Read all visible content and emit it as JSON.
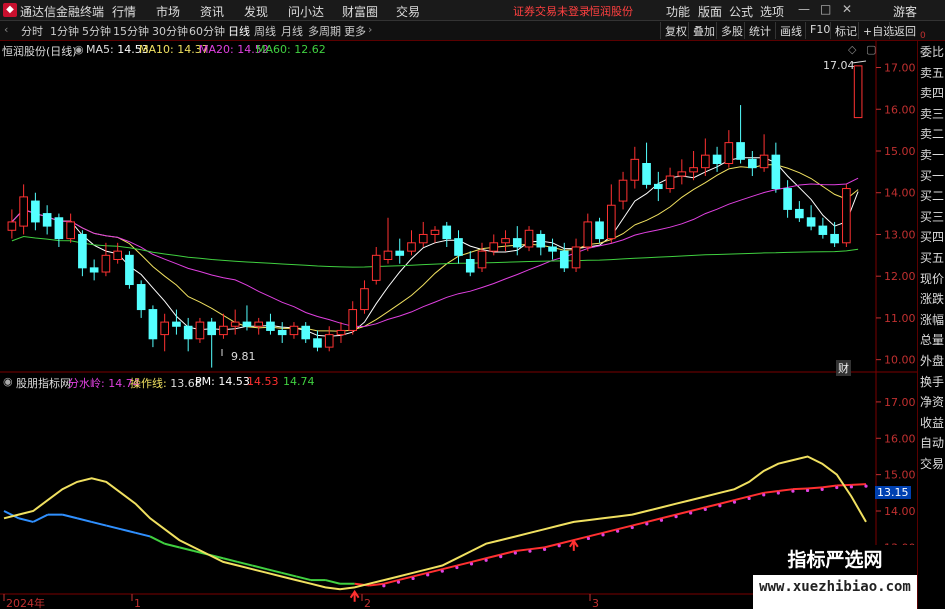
{
  "topbar": {
    "app_name": "通达信金融终端",
    "menus": [
      "行情",
      "市场",
      "资讯",
      "发现",
      "问小达",
      "财富圈",
      "交易"
    ],
    "warning": "证券交易未登录",
    "stock_name": "恒润股份",
    "right_menus": [
      "功能",
      "版面",
      "公式",
      "选项"
    ],
    "user": "游客"
  },
  "toolbar": {
    "periods": [
      "分时",
      "1分钟",
      "5分钟",
      "15分钟",
      "30分钟",
      "60分钟",
      "日线",
      "周线",
      "月线",
      "多周期",
      "更多"
    ],
    "active_period": "日线",
    "buttons": [
      "复权",
      "叠加",
      "多股",
      "统计",
      "画线",
      "F10",
      "标记",
      "+自选",
      "返回"
    ]
  },
  "right_column": {
    "top_label": "0",
    "items": [
      "委比",
      "卖五",
      "卖四",
      "卖三",
      "卖二",
      "卖一",
      "买一",
      "买二",
      "买三",
      "买四",
      "买五",
      "现价",
      "涨跌",
      "涨幅",
      "总量",
      "外盘",
      "换手",
      "净资",
      "收益",
      "自动",
      "交易"
    ]
  },
  "main_chart": {
    "title": "恒润股份(日线)",
    "ma": [
      {
        "label": "MA5:",
        "value": "14.53",
        "color": "#ffffff"
      },
      {
        "label": "MA10:",
        "value": "14.37",
        "color": "#f0e060"
      },
      {
        "label": "MA20:",
        "value": "14.52",
        "color": "#e040e0"
      },
      {
        "label": "MA60:",
        "value": "12.62",
        "color": "#40d040"
      }
    ],
    "y_ticks": [
      "17.00",
      "16.00",
      "15.00",
      "14.00",
      "13.00",
      "12.00",
      "11.00",
      "10.00"
    ],
    "high_label": "17.04",
    "low_label": "9.81",
    "marker_label": "财"
  },
  "sub_chart": {
    "indicator_name": "股朋指标网",
    "fields": [
      {
        "label": "分水岭:",
        "value": "14.74",
        "color": "#e040e0"
      },
      {
        "label": "操作线:",
        "value": "13.68",
        "color": "#f0e060"
      },
      {
        "label": "PM:",
        "value": "14.53",
        "color": "#ffffff"
      },
      {
        "label": "",
        "value": "14.53",
        "color": "#ff3030"
      },
      {
        "label": "",
        "value": "14.74",
        "color": "#40d040"
      }
    ],
    "y_ticks": [
      "17.00",
      "16.00",
      "15.00",
      "14.00",
      "13.00",
      "12.00"
    ],
    "current_value": "13.15"
  },
  "x_axis": {
    "labels": [
      "2024年",
      "1",
      "2",
      "3"
    ]
  },
  "watermark": {
    "title": "指标严选网",
    "url": "www.xuezhibiao.com"
  },
  "chart_data": {
    "type": "candlestick",
    "title": "恒润股份(日线)",
    "ylim": [
      9.8,
      17.3
    ],
    "candles": [
      {
        "o": 13.1,
        "c": 13.3,
        "h": 13.6,
        "l": 12.9
      },
      {
        "o": 13.2,
        "c": 13.9,
        "h": 14.2,
        "l": 13.0
      },
      {
        "o": 13.8,
        "c": 13.3,
        "h": 14.0,
        "l": 13.1
      },
      {
        "o": 13.5,
        "c": 13.2,
        "h": 13.7,
        "l": 13.0
      },
      {
        "o": 13.4,
        "c": 12.9,
        "h": 13.5,
        "l": 12.7
      },
      {
        "o": 12.9,
        "c": 13.3,
        "h": 13.5,
        "l": 12.8
      },
      {
        "o": 13.0,
        "c": 12.2,
        "h": 13.1,
        "l": 12.0
      },
      {
        "o": 12.2,
        "c": 12.1,
        "h": 12.4,
        "l": 11.9
      },
      {
        "o": 12.1,
        "c": 12.5,
        "h": 12.8,
        "l": 12.0
      },
      {
        "o": 12.4,
        "c": 12.6,
        "h": 12.8,
        "l": 12.3
      },
      {
        "o": 12.5,
        "c": 11.8,
        "h": 12.6,
        "l": 11.7
      },
      {
        "o": 11.8,
        "c": 11.2,
        "h": 11.9,
        "l": 11.0
      },
      {
        "o": 11.2,
        "c": 10.5,
        "h": 11.3,
        "l": 10.3
      },
      {
        "o": 10.6,
        "c": 10.9,
        "h": 11.1,
        "l": 10.2
      },
      {
        "o": 10.9,
        "c": 10.8,
        "h": 11.2,
        "l": 10.6
      },
      {
        "o": 10.8,
        "c": 10.5,
        "h": 11.0,
        "l": 10.2
      },
      {
        "o": 10.5,
        "c": 10.9,
        "h": 11.0,
        "l": 10.4
      },
      {
        "o": 10.9,
        "c": 10.6,
        "h": 11.0,
        "l": 9.81
      },
      {
        "o": 10.6,
        "c": 10.8,
        "h": 11.1,
        "l": 10.5
      },
      {
        "o": 10.8,
        "c": 10.9,
        "h": 11.2,
        "l": 10.6
      },
      {
        "o": 10.9,
        "c": 10.8,
        "h": 11.3,
        "l": 10.7
      },
      {
        "o": 10.8,
        "c": 10.9,
        "h": 11.0,
        "l": 10.6
      },
      {
        "o": 10.9,
        "c": 10.7,
        "h": 11.1,
        "l": 10.6
      },
      {
        "o": 10.7,
        "c": 10.6,
        "h": 10.9,
        "l": 10.4
      },
      {
        "o": 10.6,
        "c": 10.8,
        "h": 10.9,
        "l": 10.5
      },
      {
        "o": 10.8,
        "c": 10.5,
        "h": 10.9,
        "l": 10.4
      },
      {
        "o": 10.5,
        "c": 10.3,
        "h": 10.7,
        "l": 10.2
      },
      {
        "o": 10.3,
        "c": 10.6,
        "h": 10.8,
        "l": 10.2
      },
      {
        "o": 10.6,
        "c": 10.7,
        "h": 10.9,
        "l": 10.4
      },
      {
        "o": 10.7,
        "c": 11.2,
        "h": 11.4,
        "l": 10.6
      },
      {
        "o": 11.2,
        "c": 11.7,
        "h": 11.9,
        "l": 11.1
      },
      {
        "o": 11.9,
        "c": 12.5,
        "h": 12.7,
        "l": 11.8
      },
      {
        "o": 12.4,
        "c": 12.6,
        "h": 13.4,
        "l": 12.3
      },
      {
        "o": 12.6,
        "c": 12.5,
        "h": 12.9,
        "l": 12.3
      },
      {
        "o": 12.6,
        "c": 12.8,
        "h": 13.1,
        "l": 12.5
      },
      {
        "o": 12.8,
        "c": 13.0,
        "h": 13.3,
        "l": 12.7
      },
      {
        "o": 13.0,
        "c": 13.1,
        "h": 13.2,
        "l": 12.8
      },
      {
        "o": 13.2,
        "c": 12.9,
        "h": 13.3,
        "l": 12.7
      },
      {
        "o": 12.9,
        "c": 12.5,
        "h": 13.1,
        "l": 12.3
      },
      {
        "o": 12.4,
        "c": 12.1,
        "h": 12.6,
        "l": 12.0
      },
      {
        "o": 12.2,
        "c": 12.6,
        "h": 12.8,
        "l": 12.1
      },
      {
        "o": 12.6,
        "c": 12.8,
        "h": 13.0,
        "l": 12.5
      },
      {
        "o": 12.8,
        "c": 12.9,
        "h": 13.1,
        "l": 12.6
      },
      {
        "o": 12.9,
        "c": 12.7,
        "h": 13.2,
        "l": 12.5
      },
      {
        "o": 12.7,
        "c": 13.1,
        "h": 13.2,
        "l": 12.6
      },
      {
        "o": 13.0,
        "c": 12.7,
        "h": 13.1,
        "l": 12.5
      },
      {
        "o": 12.7,
        "c": 12.6,
        "h": 12.9,
        "l": 12.4
      },
      {
        "o": 12.6,
        "c": 12.2,
        "h": 12.8,
        "l": 12.1
      },
      {
        "o": 12.2,
        "c": 12.7,
        "h": 12.9,
        "l": 12.1
      },
      {
        "o": 12.7,
        "c": 13.3,
        "h": 13.5,
        "l": 12.6
      },
      {
        "o": 13.3,
        "c": 12.9,
        "h": 13.4,
        "l": 12.8
      },
      {
        "o": 12.9,
        "c": 13.7,
        "h": 14.2,
        "l": 12.8
      },
      {
        "o": 13.8,
        "c": 14.3,
        "h": 14.5,
        "l": 13.6
      },
      {
        "o": 14.3,
        "c": 14.8,
        "h": 15.1,
        "l": 14.1
      },
      {
        "o": 14.7,
        "c": 14.2,
        "h": 15.2,
        "l": 14.1
      },
      {
        "o": 14.2,
        "c": 14.1,
        "h": 14.5,
        "l": 13.8
      },
      {
        "o": 14.1,
        "c": 14.4,
        "h": 14.6,
        "l": 14.0
      },
      {
        "o": 14.4,
        "c": 14.5,
        "h": 14.8,
        "l": 14.2
      },
      {
        "o": 14.5,
        "c": 14.6,
        "h": 15.0,
        "l": 14.3
      },
      {
        "o": 14.6,
        "c": 14.9,
        "h": 15.3,
        "l": 14.4
      },
      {
        "o": 14.9,
        "c": 14.7,
        "h": 15.1,
        "l": 14.5
      },
      {
        "o": 14.7,
        "c": 15.2,
        "h": 15.5,
        "l": 14.6
      },
      {
        "o": 15.2,
        "c": 14.8,
        "h": 16.1,
        "l": 14.7
      },
      {
        "o": 14.8,
        "c": 14.6,
        "h": 15.0,
        "l": 14.4
      },
      {
        "o": 14.6,
        "c": 14.9,
        "h": 15.4,
        "l": 14.5
      },
      {
        "o": 14.9,
        "c": 14.1,
        "h": 15.2,
        "l": 14.0
      },
      {
        "o": 14.1,
        "c": 13.6,
        "h": 14.3,
        "l": 13.4
      },
      {
        "o": 13.6,
        "c": 13.4,
        "h": 13.8,
        "l": 13.3
      },
      {
        "o": 13.4,
        "c": 13.2,
        "h": 13.7,
        "l": 13.1
      },
      {
        "o": 13.2,
        "c": 13.0,
        "h": 13.4,
        "l": 12.9
      },
      {
        "o": 13.0,
        "c": 12.8,
        "h": 13.3,
        "l": 12.7
      },
      {
        "o": 12.8,
        "c": 14.1,
        "h": 14.2,
        "l": 12.7
      },
      {
        "o": 15.8,
        "c": 17.04,
        "h": 17.04,
        "l": 15.8
      }
    ],
    "ma_series": [
      {
        "name": "MA5",
        "color": "#ffffff"
      },
      {
        "name": "MA10",
        "color": "#f0e060"
      },
      {
        "name": "MA20",
        "color": "#e040e0"
      },
      {
        "name": "MA60",
        "color": "#40d040"
      }
    ],
    "sub_ylim": [
      11.8,
      17.3
    ],
    "sub_series": [
      {
        "name": "分水岭",
        "color": "#e040e0",
        "values": [
          14.0,
          13.8,
          13.7,
          13.9,
          13.9,
          13.8,
          13.7,
          13.6,
          13.5,
          13.4,
          13.3,
          13.1,
          13.0,
          12.9,
          12.8,
          12.7,
          12.6,
          12.5,
          12.4,
          12.3,
          12.2,
          12.1,
          12.1,
          12.0,
          12.0,
          11.95,
          12.0,
          12.1,
          12.2,
          12.3,
          12.4,
          12.5,
          12.6,
          12.7,
          12.8,
          12.9,
          12.95,
          13.0,
          13.1,
          13.2,
          13.3,
          13.4,
          13.5,
          13.6,
          13.7,
          13.8,
          13.9,
          14.0,
          14.1,
          14.2,
          14.3,
          14.4,
          14.5,
          14.55,
          14.6,
          14.62,
          14.65,
          14.7,
          14.72,
          14.74
        ]
      },
      {
        "name": "操作线",
        "color": "#f0e060",
        "values": [
          13.8,
          13.9,
          14.0,
          14.3,
          14.6,
          14.8,
          14.9,
          14.8,
          14.5,
          14.2,
          13.8,
          13.5,
          13.2,
          13.0,
          12.8,
          12.6,
          12.5,
          12.4,
          12.3,
          12.2,
          12.1,
          12.0,
          11.9,
          11.85,
          11.9,
          12.0,
          12.1,
          12.2,
          12.3,
          12.4,
          12.5,
          12.7,
          12.9,
          13.1,
          13.2,
          13.3,
          13.4,
          13.5,
          13.6,
          13.7,
          13.75,
          13.8,
          13.85,
          13.9,
          14.0,
          14.1,
          14.2,
          14.3,
          14.4,
          14.5,
          14.6,
          14.8,
          15.1,
          15.3,
          15.4,
          15.5,
          15.3,
          15.0,
          14.4,
          13.7
        ]
      }
    ]
  }
}
